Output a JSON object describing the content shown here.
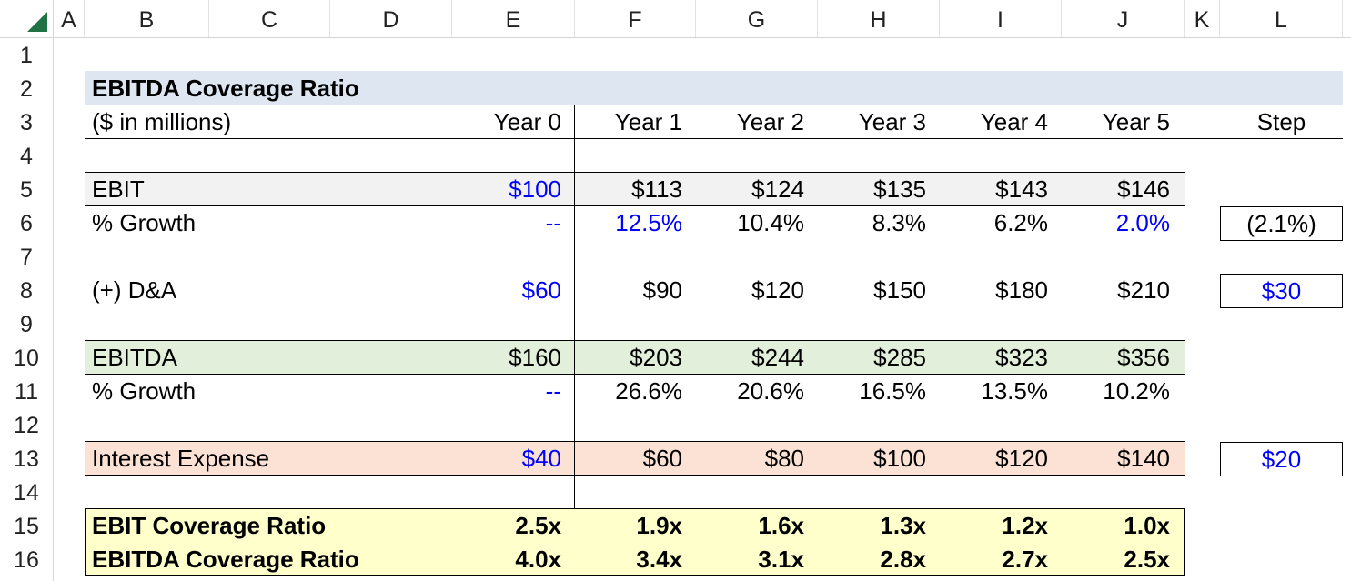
{
  "columns": [
    "A",
    "B",
    "C",
    "D",
    "E",
    "F",
    "G",
    "H",
    "I",
    "J",
    "K",
    "L"
  ],
  "rows": [
    "1",
    "2",
    "3",
    "4",
    "5",
    "6",
    "7",
    "8",
    "9",
    "10",
    "11",
    "12",
    "13",
    "14",
    "15",
    "16"
  ],
  "title": "EBITDA Coverage Ratio",
  "units_label": "($ in millions)",
  "year_headers": [
    "Year 0",
    "Year 1",
    "Year 2",
    "Year 3",
    "Year 4",
    "Year 5"
  ],
  "step_header": "Step",
  "table": {
    "ebit": {
      "label": "EBIT",
      "values": [
        "$100",
        "$113",
        "$124",
        "$135",
        "$143",
        "$146"
      ]
    },
    "ebit_growth": {
      "label": "% Growth",
      "values": [
        "--",
        "12.5%",
        "10.4%",
        "8.3%",
        "6.2%",
        "2.0%"
      ],
      "step": "(2.1%)"
    },
    "da": {
      "label": "(+) D&A",
      "values": [
        "$60",
        "$90",
        "$120",
        "$150",
        "$180",
        "$210"
      ],
      "step": "$30"
    },
    "ebitda": {
      "label": "EBITDA",
      "values": [
        "$160",
        "$203",
        "$244",
        "$285",
        "$323",
        "$356"
      ]
    },
    "ebitda_growth": {
      "label": "% Growth",
      "values": [
        "--",
        "26.6%",
        "20.6%",
        "16.5%",
        "13.5%",
        "10.2%"
      ]
    },
    "interest": {
      "label": "Interest Expense",
      "values": [
        "$40",
        "$60",
        "$80",
        "$100",
        "$120",
        "$140"
      ],
      "step": "$20"
    },
    "ebit_cov": {
      "label": "EBIT Coverage Ratio",
      "values": [
        "2.5x",
        "1.9x",
        "1.6x",
        "1.3x",
        "1.2x",
        "1.0x"
      ]
    },
    "ebitda_cov": {
      "label": "EBITDA Coverage Ratio",
      "values": [
        "4.0x",
        "3.4x",
        "3.1x",
        "2.8x",
        "2.7x",
        "2.5x"
      ]
    }
  },
  "colors": {
    "title_fill": "#dde6f1",
    "ebit_fill": "#f2f2f2",
    "ebitda_fill": "#e2efda",
    "interest_fill": "#fbe2d5",
    "coverage_fill": "#ffffcc",
    "input_blue": "#0000ff",
    "excel_green": "#217346"
  }
}
